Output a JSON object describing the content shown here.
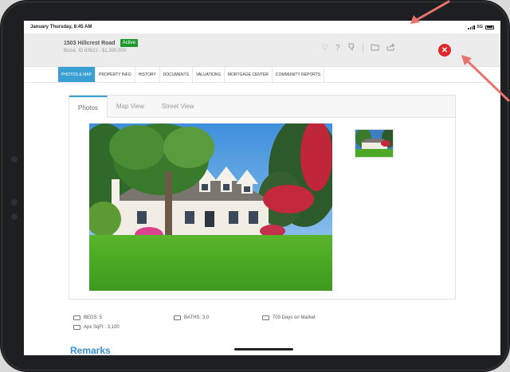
{
  "status_bar": {
    "time": "January Thursday, 8:45 AM",
    "network": "5G"
  },
  "listing": {
    "address": "1503 Hillcrest Road",
    "status": "Active",
    "subtitle": "Boise, ID 83622 - $1,300,000"
  },
  "header_icons": [
    "heart-icon",
    "help-icon",
    "thumbs-down-icon",
    "folder-icon",
    "share-icon",
    "close-icon"
  ],
  "nav": {
    "tabs": [
      {
        "label": "PHOTOS & MAP",
        "active": true
      },
      {
        "label": "PROPERTY INFO",
        "active": false
      },
      {
        "label": "HISTORY",
        "active": false
      },
      {
        "label": "DOCUMENTS",
        "active": false
      },
      {
        "label": "VALUATIONS",
        "active": false
      },
      {
        "label": "MORTGAGE CENTER",
        "active": false
      },
      {
        "label": "COMMUNITY REPORTS",
        "active": false
      }
    ]
  },
  "media_tabs": [
    {
      "label": "Photos",
      "active": true
    },
    {
      "label": "Map View",
      "active": false
    },
    {
      "label": "Street View",
      "active": false
    }
  ],
  "stats": {
    "beds": "BEDS: 5",
    "baths": "BATHS: 3.0",
    "days": "703 Days on Market",
    "sqft": "Apx SqFt : 3,100"
  },
  "remarks_title": "Remarks",
  "colors": {
    "accent": "#3aa0d4",
    "active_badge": "#1f9a2f",
    "close": "#e0262b",
    "annotation_arrow": "#e8736c"
  }
}
